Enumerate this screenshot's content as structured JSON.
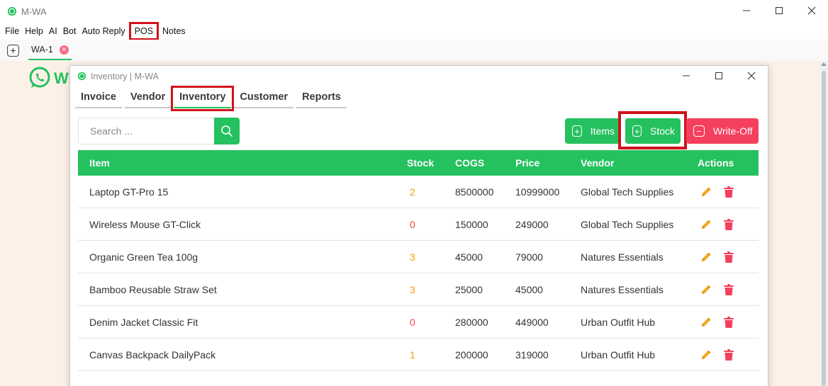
{
  "app": {
    "title": "M-WA",
    "brand_partial": "W"
  },
  "menu": [
    "File",
    "Help",
    "AI",
    "Bot",
    "Auto Reply",
    "POS",
    "Notes"
  ],
  "tabs": [
    {
      "label": "WA-1"
    }
  ],
  "dialog": {
    "title": "Inventory | M-WA",
    "nav": [
      "Invoice",
      "Vendor",
      "Inventory",
      "Customer",
      "Reports"
    ],
    "active_nav": "Inventory",
    "search_placeholder": "Search ...",
    "buttons": {
      "items": "Items",
      "stock": "Stock",
      "writeoff": "Write-Off"
    },
    "columns": {
      "item": "Item",
      "stock": "Stock",
      "cogs": "COGS",
      "price": "Price",
      "vendor": "Vendor",
      "actions": "Actions"
    },
    "rows": [
      {
        "item": "Laptop GT-Pro 15",
        "stock": "2",
        "cogs": "8500000",
        "price": "10999000",
        "vendor": "Global Tech Supplies"
      },
      {
        "item": "Wireless Mouse GT-Click",
        "stock": "0",
        "cogs": "150000",
        "price": "249000",
        "vendor": "Global Tech Supplies"
      },
      {
        "item": "Organic Green Tea 100g",
        "stock": "3",
        "cogs": "45000",
        "price": "79000",
        "vendor": "Natures Essentials"
      },
      {
        "item": "Bamboo Reusable Straw Set",
        "stock": "3",
        "cogs": "25000",
        "price": "45000",
        "vendor": "Natures Essentials"
      },
      {
        "item": "Denim Jacket Classic Fit",
        "stock": "0",
        "cogs": "280000",
        "price": "449000",
        "vendor": "Urban Outfit Hub"
      },
      {
        "item": "Canvas Backpack DailyPack",
        "stock": "1",
        "cogs": "200000",
        "price": "319000",
        "vendor": "Urban Outfit Hub"
      }
    ]
  },
  "colors": {
    "accent": "#25c15f",
    "danger": "#f43f5e",
    "warning": "#f59e0b",
    "highlight": "#d0121b"
  }
}
